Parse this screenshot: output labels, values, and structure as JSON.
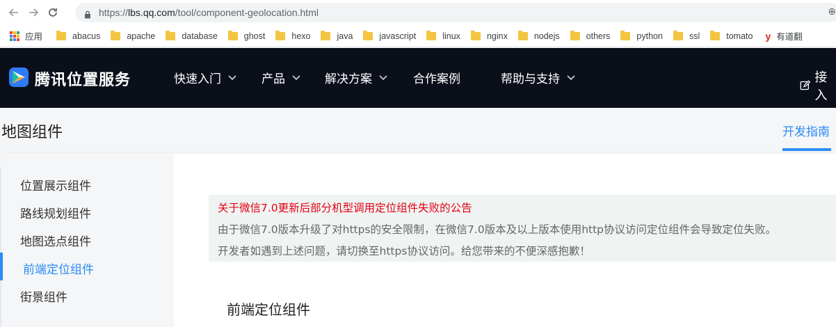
{
  "browser": {
    "url_scheme": "https://",
    "url_host": "lbs.qq.com",
    "url_path": "/tool/component-geolocation.html",
    "nav_icons": [
      "back-arrow-icon",
      "forward-arrow-icon",
      "reload-icon",
      "lock-icon"
    ]
  },
  "bookmarks": {
    "apps_label": "应用",
    "items": [
      "abacus",
      "apache",
      "database",
      "ghost",
      "hexo",
      "java",
      "javascript",
      "linux",
      "nginx",
      "nodejs",
      "others",
      "python",
      "ssl",
      "tomato"
    ],
    "youdao_label": "有道翻"
  },
  "header": {
    "brand": "腾讯位置服务",
    "menu": [
      {
        "label": "快速入门",
        "has_dropdown": true
      },
      {
        "label": "产品",
        "has_dropdown": true
      },
      {
        "label": "解决方案",
        "has_dropdown": true
      },
      {
        "label": "合作案例",
        "has_dropdown": false
      },
      {
        "label": "帮助与支持",
        "has_dropdown": true
      }
    ],
    "login_label": "接入"
  },
  "subheader": {
    "title": "地图组件",
    "tab": "开发指南"
  },
  "sidebar": {
    "items": [
      {
        "label": "位置展示组件",
        "active": false
      },
      {
        "label": "路线规划组件",
        "active": false
      },
      {
        "label": "地图选点组件",
        "active": false
      },
      {
        "label": "前端定位组件",
        "active": true
      },
      {
        "label": "街景组件",
        "active": false
      }
    ]
  },
  "notice": {
    "title": "关于微信7.0更新后部分机型调用定位组件失败的公告",
    "line1": "由于微信7.0版本升级了对https的安全限制，在微信7.0版本及以上版本使用http协议访问定位组件会导致定位失败。",
    "line2": "开发者如遇到上述问题，请切换至https协议访问。给您带来的不便深感抱歉！"
  },
  "content": {
    "section_title": "前端定位组件"
  },
  "colors": {
    "accent": "#2b8cf5",
    "header_bg": "#0b0f1a",
    "notice_title": "#e60012",
    "notice_bg": "#eff4f3"
  }
}
